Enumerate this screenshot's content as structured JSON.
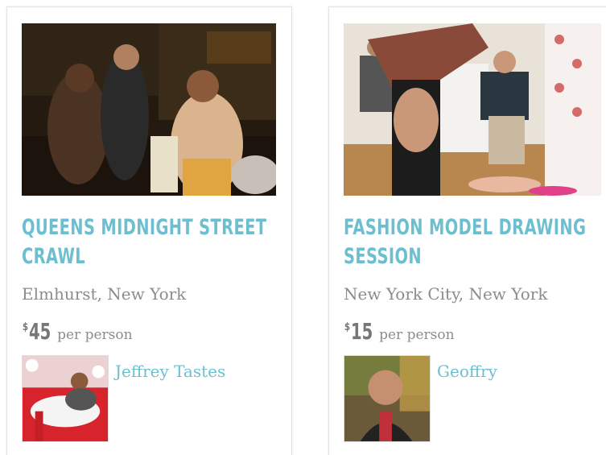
{
  "cards": [
    {
      "title_line1": "Queens Midnight Street",
      "title_line2": "Crawl",
      "location": "Elmhurst, New York",
      "currency": "$",
      "price": "45",
      "price_unit": "per person",
      "host_name": "Jeffrey Tastes"
    },
    {
      "title_line1": "Fashion Model Drawing",
      "title_line2": "Session",
      "location": "New York City, New York",
      "currency": "$",
      "price": "15",
      "price_unit": "per person",
      "host_name": "Geoffry"
    }
  ],
  "colors": {
    "accent": "#6dbfcf",
    "muted_text": "#8c8c8c"
  }
}
